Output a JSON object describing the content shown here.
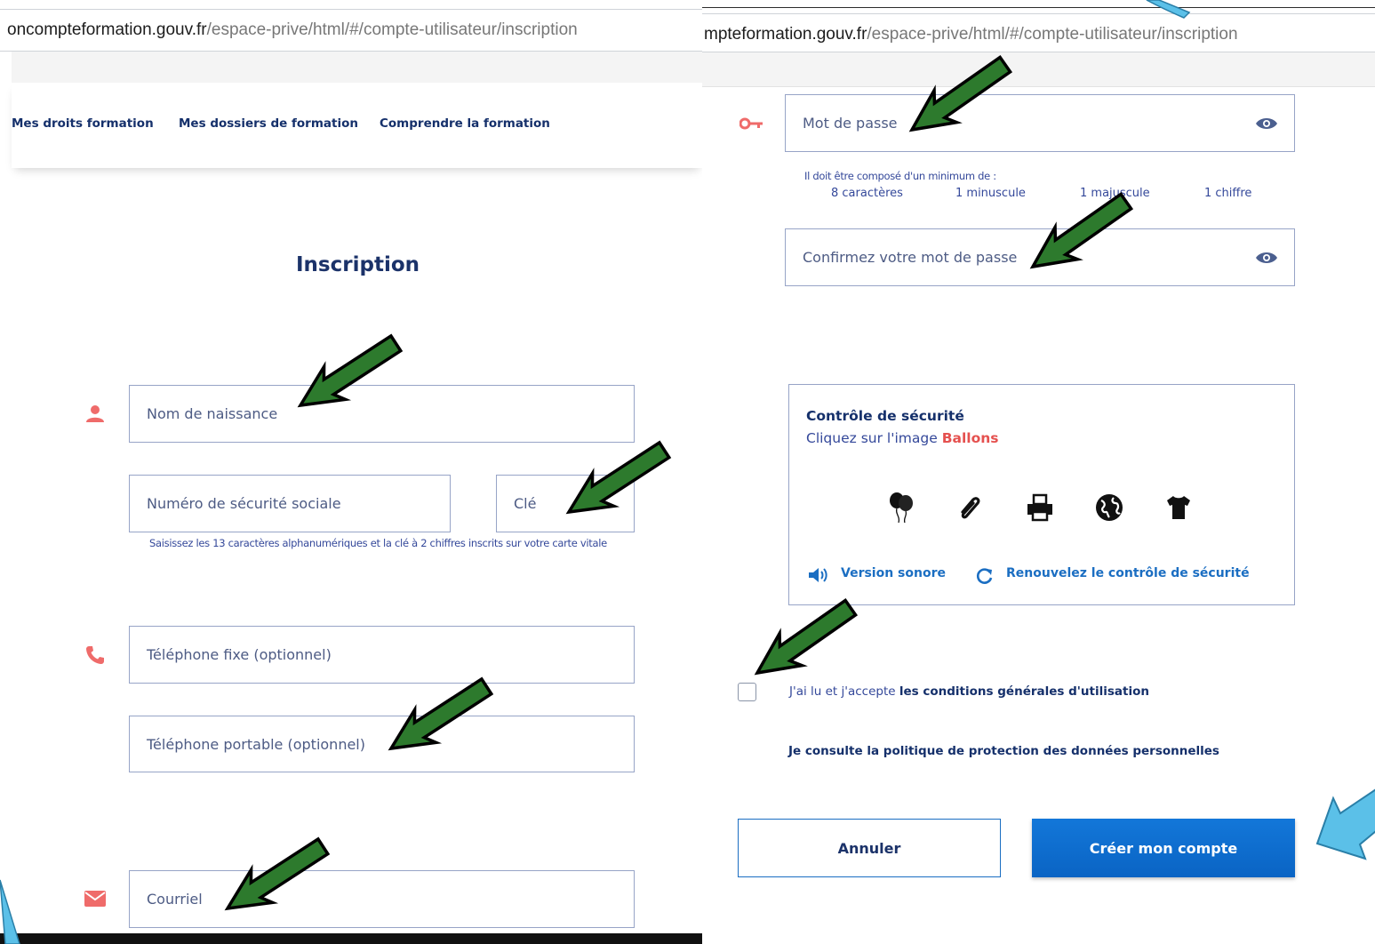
{
  "left": {
    "url": {
      "host": "oncompteformation.gouv.fr",
      "path": "/espace-prive/html/#/compte-utilisateur/inscription"
    },
    "nav": [
      "Mes droits formation",
      "Mes dossiers de formation",
      "Comprendre la formation"
    ],
    "title": "Inscription",
    "fields": {
      "birth_name": "Nom de naissance",
      "ssn": "Numéro de sécurité sociale",
      "key": "Clé",
      "ssn_hint": "Saisissez les 13 caractères alphanumériques et la clé à 2 chiffres inscrits sur votre carte vitale",
      "landline": "Téléphone fixe (optionnel)",
      "mobile": "Téléphone portable (optionnel)",
      "email": "Courriel"
    }
  },
  "right": {
    "url": {
      "host": "mpteformation.gouv.fr",
      "path": "/espace-prive/html/#/compte-utilisateur/inscription"
    },
    "password": "Mot de passe",
    "password_rules_title": "Il doit être composé d'un minimum de :",
    "password_rules": [
      "8 caractères",
      "1 minuscule",
      "1 majuscule",
      "1 chiffre"
    ],
    "confirm_password": "Confirmez votre mot de passe",
    "security": {
      "title": "Contrôle de sécurité",
      "instruction": "Cliquez sur l'image",
      "target": "Ballons",
      "images": [
        "balloons-icon",
        "paperclip-icon",
        "printer-icon",
        "globe-icon",
        "tshirt-icon"
      ],
      "audio": "Version sonore",
      "refresh": "Renouvelez le contrôle de sécurité"
    },
    "terms_prefix": "J'ai lu et j'accepte",
    "terms_link": "les conditions générales d'utilisation",
    "privacy": "Je consulte la politique de protection des données personnelles",
    "cancel": "Annuler",
    "create": "Créer mon compte"
  },
  "colors": {
    "navy": "#15306b",
    "accent_red": "#e5514f",
    "button_blue": "#0a6cd0",
    "annotation_green": "#2d7a2d",
    "annotation_cyan": "#5bc0e8"
  }
}
